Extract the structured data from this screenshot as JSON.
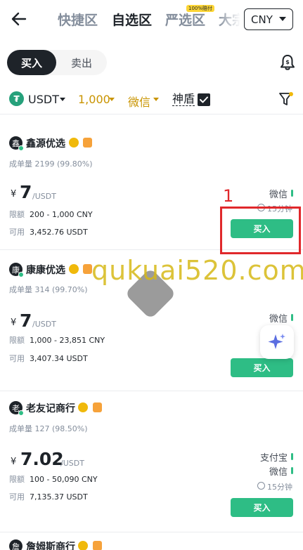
{
  "header": {
    "tabs": [
      {
        "label": "快捷区"
      },
      {
        "label": "自选区"
      },
      {
        "label": "严选区"
      },
      {
        "label": "大宗"
      }
    ],
    "tab_badge": "100%赔付",
    "currency": "CNY"
  },
  "trade": {
    "buy_label": "买入",
    "sell_label": "卖出"
  },
  "filters": {
    "coin": "USDT",
    "amount": "1,000",
    "payment": "微信",
    "shield_label": "神盾"
  },
  "ads": [
    {
      "avatar": "鑫",
      "merchant": "鑫源优选",
      "stats_label": "成单量",
      "stats_value": "2199 (99.80%)",
      "currency_symbol": "¥",
      "price": "7",
      "price_unit": "/USDT",
      "limit_label": "限额",
      "limit_value": "200 - 1,000 CNY",
      "available_label": "可用",
      "available_value": "3,452.76 USDT",
      "payments": [
        "微信"
      ],
      "time_limit": "15分钟",
      "buy_label": "买入"
    },
    {
      "avatar": "康",
      "merchant": "康康优选",
      "stats_label": "成单量",
      "stats_value": "314 (99.70%)",
      "currency_symbol": "¥",
      "price": "7",
      "price_unit": "/USDT",
      "limit_label": "限额",
      "limit_value": "1,000 - 23,851 CNY",
      "available_label": "可用",
      "available_value": "3,407.34 USDT",
      "payments": [
        "微信"
      ],
      "buy_label": "买入"
    },
    {
      "avatar": "老",
      "merchant": "老友记商行",
      "stats_label": "成单量",
      "stats_value": "127 (98.50%)",
      "currency_symbol": "¥",
      "price": "7.02",
      "price_unit": "/USDT",
      "limit_label": "限额",
      "limit_value": "100 - 50,090 CNY",
      "available_label": "可用",
      "available_value": "7,135.37 USDT",
      "payments": [
        "支付宝",
        "微信"
      ],
      "time_limit": "15分钟",
      "buy_label": "买入"
    },
    {
      "avatar": "詹",
      "merchant": "詹姆斯商行"
    }
  ],
  "annotation": {
    "number": "1"
  },
  "watermark": "qukuai520.com",
  "colors": {
    "accent_gold": "#c99400",
    "buy_green": "#2ebd85",
    "annotation_red": "#e0282b",
    "dark": "#1e2329"
  }
}
